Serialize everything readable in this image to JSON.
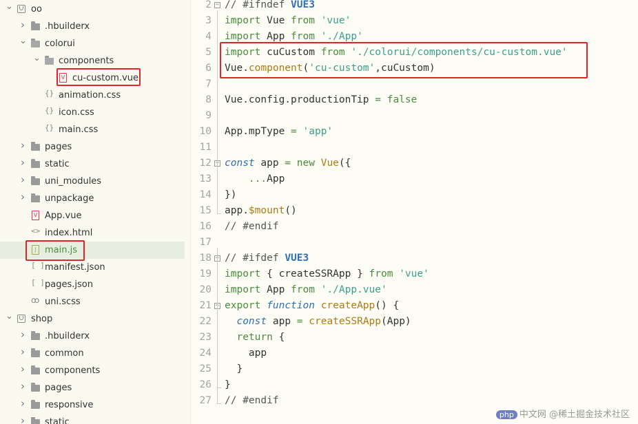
{
  "sidebar": {
    "items": [
      {
        "label": "oo",
        "kind": "project",
        "expanded": true
      },
      {
        "label": ".hbuilderx",
        "kind": "folder"
      },
      {
        "label": "colorui",
        "kind": "folder",
        "expanded": true
      },
      {
        "label": "components",
        "kind": "folder",
        "expanded": true
      },
      {
        "label": "cu-custom.vue",
        "kind": "vue-file"
      },
      {
        "label": "animation.css",
        "kind": "css-file"
      },
      {
        "label": "icon.css",
        "kind": "css-file"
      },
      {
        "label": "main.css",
        "kind": "css-file"
      },
      {
        "label": "pages",
        "kind": "folder"
      },
      {
        "label": "static",
        "kind": "folder"
      },
      {
        "label": "uni_modules",
        "kind": "folder"
      },
      {
        "label": "unpackage",
        "kind": "folder"
      },
      {
        "label": "App.vue",
        "kind": "vue-file"
      },
      {
        "label": "index.html",
        "kind": "html-file"
      },
      {
        "label": "main.js",
        "kind": "js-file",
        "selected": true
      },
      {
        "label": "manifest.json",
        "kind": "json-file"
      },
      {
        "label": "pages.json",
        "kind": "json-file"
      },
      {
        "label": "uni.scss",
        "kind": "scss-file"
      },
      {
        "label": "shop",
        "kind": "project",
        "expanded": true
      },
      {
        "label": ".hbuilderx",
        "kind": "folder"
      },
      {
        "label": "common",
        "kind": "folder"
      },
      {
        "label": "components",
        "kind": "folder"
      },
      {
        "label": "pages",
        "kind": "folder"
      },
      {
        "label": "responsive",
        "kind": "folder"
      },
      {
        "label": "static",
        "kind": "folder"
      }
    ]
  },
  "icons": {
    "css-file": "{}",
    "html-file": "<>",
    "json-file": "[ ]",
    "chevron-right": "›",
    "chevron-down": "⌄"
  },
  "editor": {
    "lines": [
      {
        "n": "2",
        "tokens": [
          [
            "cm",
            "// #ifndef "
          ],
          [
            "cmk",
            "VUE3"
          ]
        ]
      },
      {
        "n": "3",
        "tokens": [
          [
            "kw",
            "import"
          ],
          [
            "ident",
            " Vue "
          ],
          [
            "kw",
            "from"
          ],
          [
            "ident",
            " "
          ],
          [
            "str",
            "'vue'"
          ]
        ]
      },
      {
        "n": "4",
        "tokens": [
          [
            "kw",
            "import"
          ],
          [
            "ident",
            " App "
          ],
          [
            "kw",
            "from"
          ],
          [
            "ident",
            " "
          ],
          [
            "str",
            "'./App'"
          ]
        ]
      },
      {
        "n": "5",
        "tokens": [
          [
            "kw",
            "import"
          ],
          [
            "ident",
            " cuCustom "
          ],
          [
            "kw",
            "from"
          ],
          [
            "ident",
            " "
          ],
          [
            "str",
            "'./colorui/components/cu-custom.vue'"
          ]
        ]
      },
      {
        "n": "6",
        "tokens": [
          [
            "ident",
            "Vue."
          ],
          [
            "fn",
            "component"
          ],
          [
            "ident",
            "("
          ],
          [
            "str",
            "'cu-custom'"
          ],
          [
            "ident",
            ",cuCustom)"
          ]
        ]
      },
      {
        "n": "7",
        "tokens": []
      },
      {
        "n": "8",
        "tokens": [
          [
            "ident",
            "Vue.config.productionTip "
          ],
          [
            "kw",
            "="
          ],
          [
            "ident",
            " "
          ],
          [
            "kw",
            "false"
          ]
        ]
      },
      {
        "n": "9",
        "tokens": []
      },
      {
        "n": "10",
        "tokens": [
          [
            "ident",
            "App.mpType "
          ],
          [
            "kw",
            "="
          ],
          [
            "ident",
            " "
          ],
          [
            "str",
            "'app'"
          ]
        ]
      },
      {
        "n": "11",
        "tokens": []
      },
      {
        "n": "12",
        "tokens": [
          [
            "kw2",
            "const"
          ],
          [
            "ident",
            " app "
          ],
          [
            "kw",
            "="
          ],
          [
            "ident",
            " "
          ],
          [
            "kw",
            "new"
          ],
          [
            "ident",
            " "
          ],
          [
            "fn",
            "Vue"
          ],
          [
            "ident",
            "({"
          ]
        ]
      },
      {
        "n": "13",
        "tokens": [
          [
            "ident",
            "    "
          ],
          [
            "kw",
            "..."
          ],
          [
            "ident",
            "App"
          ]
        ]
      },
      {
        "n": "14",
        "tokens": [
          [
            "ident",
            "})"
          ]
        ]
      },
      {
        "n": "15",
        "tokens": [
          [
            "ident",
            "app."
          ],
          [
            "fn",
            "$mount"
          ],
          [
            "ident",
            "()"
          ]
        ]
      },
      {
        "n": "16",
        "tokens": [
          [
            "cm",
            "// #endif"
          ]
        ]
      },
      {
        "n": "17",
        "tokens": []
      },
      {
        "n": "18",
        "tokens": [
          [
            "cm",
            "// #ifdef "
          ],
          [
            "cmk",
            "VUE3"
          ]
        ]
      },
      {
        "n": "19",
        "tokens": [
          [
            "kw",
            "import"
          ],
          [
            "ident",
            " { createSSRApp } "
          ],
          [
            "kw",
            "from"
          ],
          [
            "ident",
            " "
          ],
          [
            "str",
            "'vue'"
          ]
        ]
      },
      {
        "n": "20",
        "tokens": [
          [
            "kw",
            "import"
          ],
          [
            "ident",
            " App "
          ],
          [
            "kw",
            "from"
          ],
          [
            "ident",
            " "
          ],
          [
            "str",
            "'./App.vue'"
          ]
        ]
      },
      {
        "n": "21",
        "tokens": [
          [
            "kw",
            "export"
          ],
          [
            "ident",
            " "
          ],
          [
            "kw2",
            "function"
          ],
          [
            "ident",
            " "
          ],
          [
            "fn",
            "createApp"
          ],
          [
            "ident",
            "() {"
          ]
        ]
      },
      {
        "n": "22",
        "tokens": [
          [
            "ident",
            "  "
          ],
          [
            "kw2",
            "const"
          ],
          [
            "ident",
            " app "
          ],
          [
            "kw",
            "="
          ],
          [
            "ident",
            " "
          ],
          [
            "fn",
            "createSSRApp"
          ],
          [
            "ident",
            "(App)"
          ]
        ]
      },
      {
        "n": "23",
        "tokens": [
          [
            "ident",
            "  "
          ],
          [
            "kw",
            "return"
          ],
          [
            "ident",
            " {"
          ]
        ]
      },
      {
        "n": "24",
        "tokens": [
          [
            "ident",
            "    app"
          ]
        ]
      },
      {
        "n": "25",
        "tokens": [
          [
            "ident",
            "  }"
          ]
        ]
      },
      {
        "n": "26",
        "tokens": [
          [
            "ident",
            "}"
          ]
        ]
      },
      {
        "n": "27",
        "tokens": [
          [
            "cm",
            "// #endif"
          ]
        ]
      }
    ]
  },
  "watermark": {
    "logo": "php",
    "text": "中文网",
    "site": "@稀土掘金技术社区"
  }
}
